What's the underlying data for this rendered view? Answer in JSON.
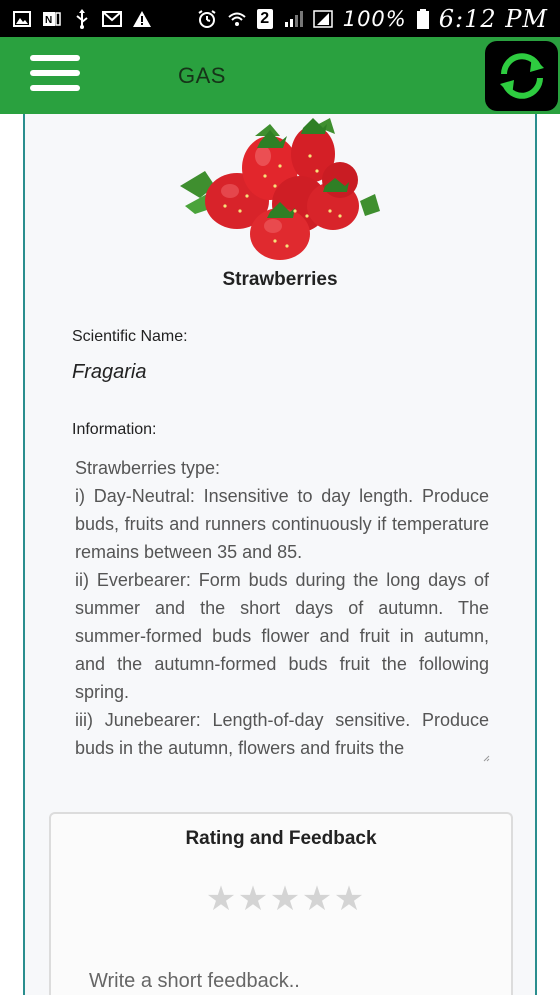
{
  "status_bar": {
    "battery_percent": "100%",
    "time": "6:12 PM",
    "sim_slot": "2",
    "icons": [
      "image-icon",
      "onenote-icon",
      "usb-icon",
      "gmail-icon",
      "warning-icon",
      "alarm-icon",
      "wifi-icon",
      "signal-icon",
      "signal-icon",
      "battery-icon"
    ]
  },
  "app_bar": {
    "title": "GAS",
    "color": "#2aa13f",
    "icons": [
      "menu-icon",
      "refresh-icon"
    ]
  },
  "fruit": {
    "name": "Strawberries",
    "scientific_name_label": "Scientific Name:",
    "scientific_name": "Fragaria",
    "information_label": "Information:",
    "information": "Strawberries type:\ni) Day-Neutral: Insensitive to day length. Produce buds, fruits and runners continuously if temperature remains between 35 and 85.\nii) Everbearer: Form buds during the long days of summer and the short days of autumn. The summer-formed buds flower and fruit in autumn, and the autumn-formed buds fruit the following spring.\niii) Junebearer: Length-of-day sensitive. Produce buds in the autumn, flowers and fruits the"
  },
  "rating": {
    "title": "Rating and Feedback",
    "stars": [
      "★",
      "★",
      "★",
      "★",
      "★"
    ],
    "rating_value": 0,
    "max_rating": 5,
    "feedback_placeholder": "Write a short feedback.."
  }
}
